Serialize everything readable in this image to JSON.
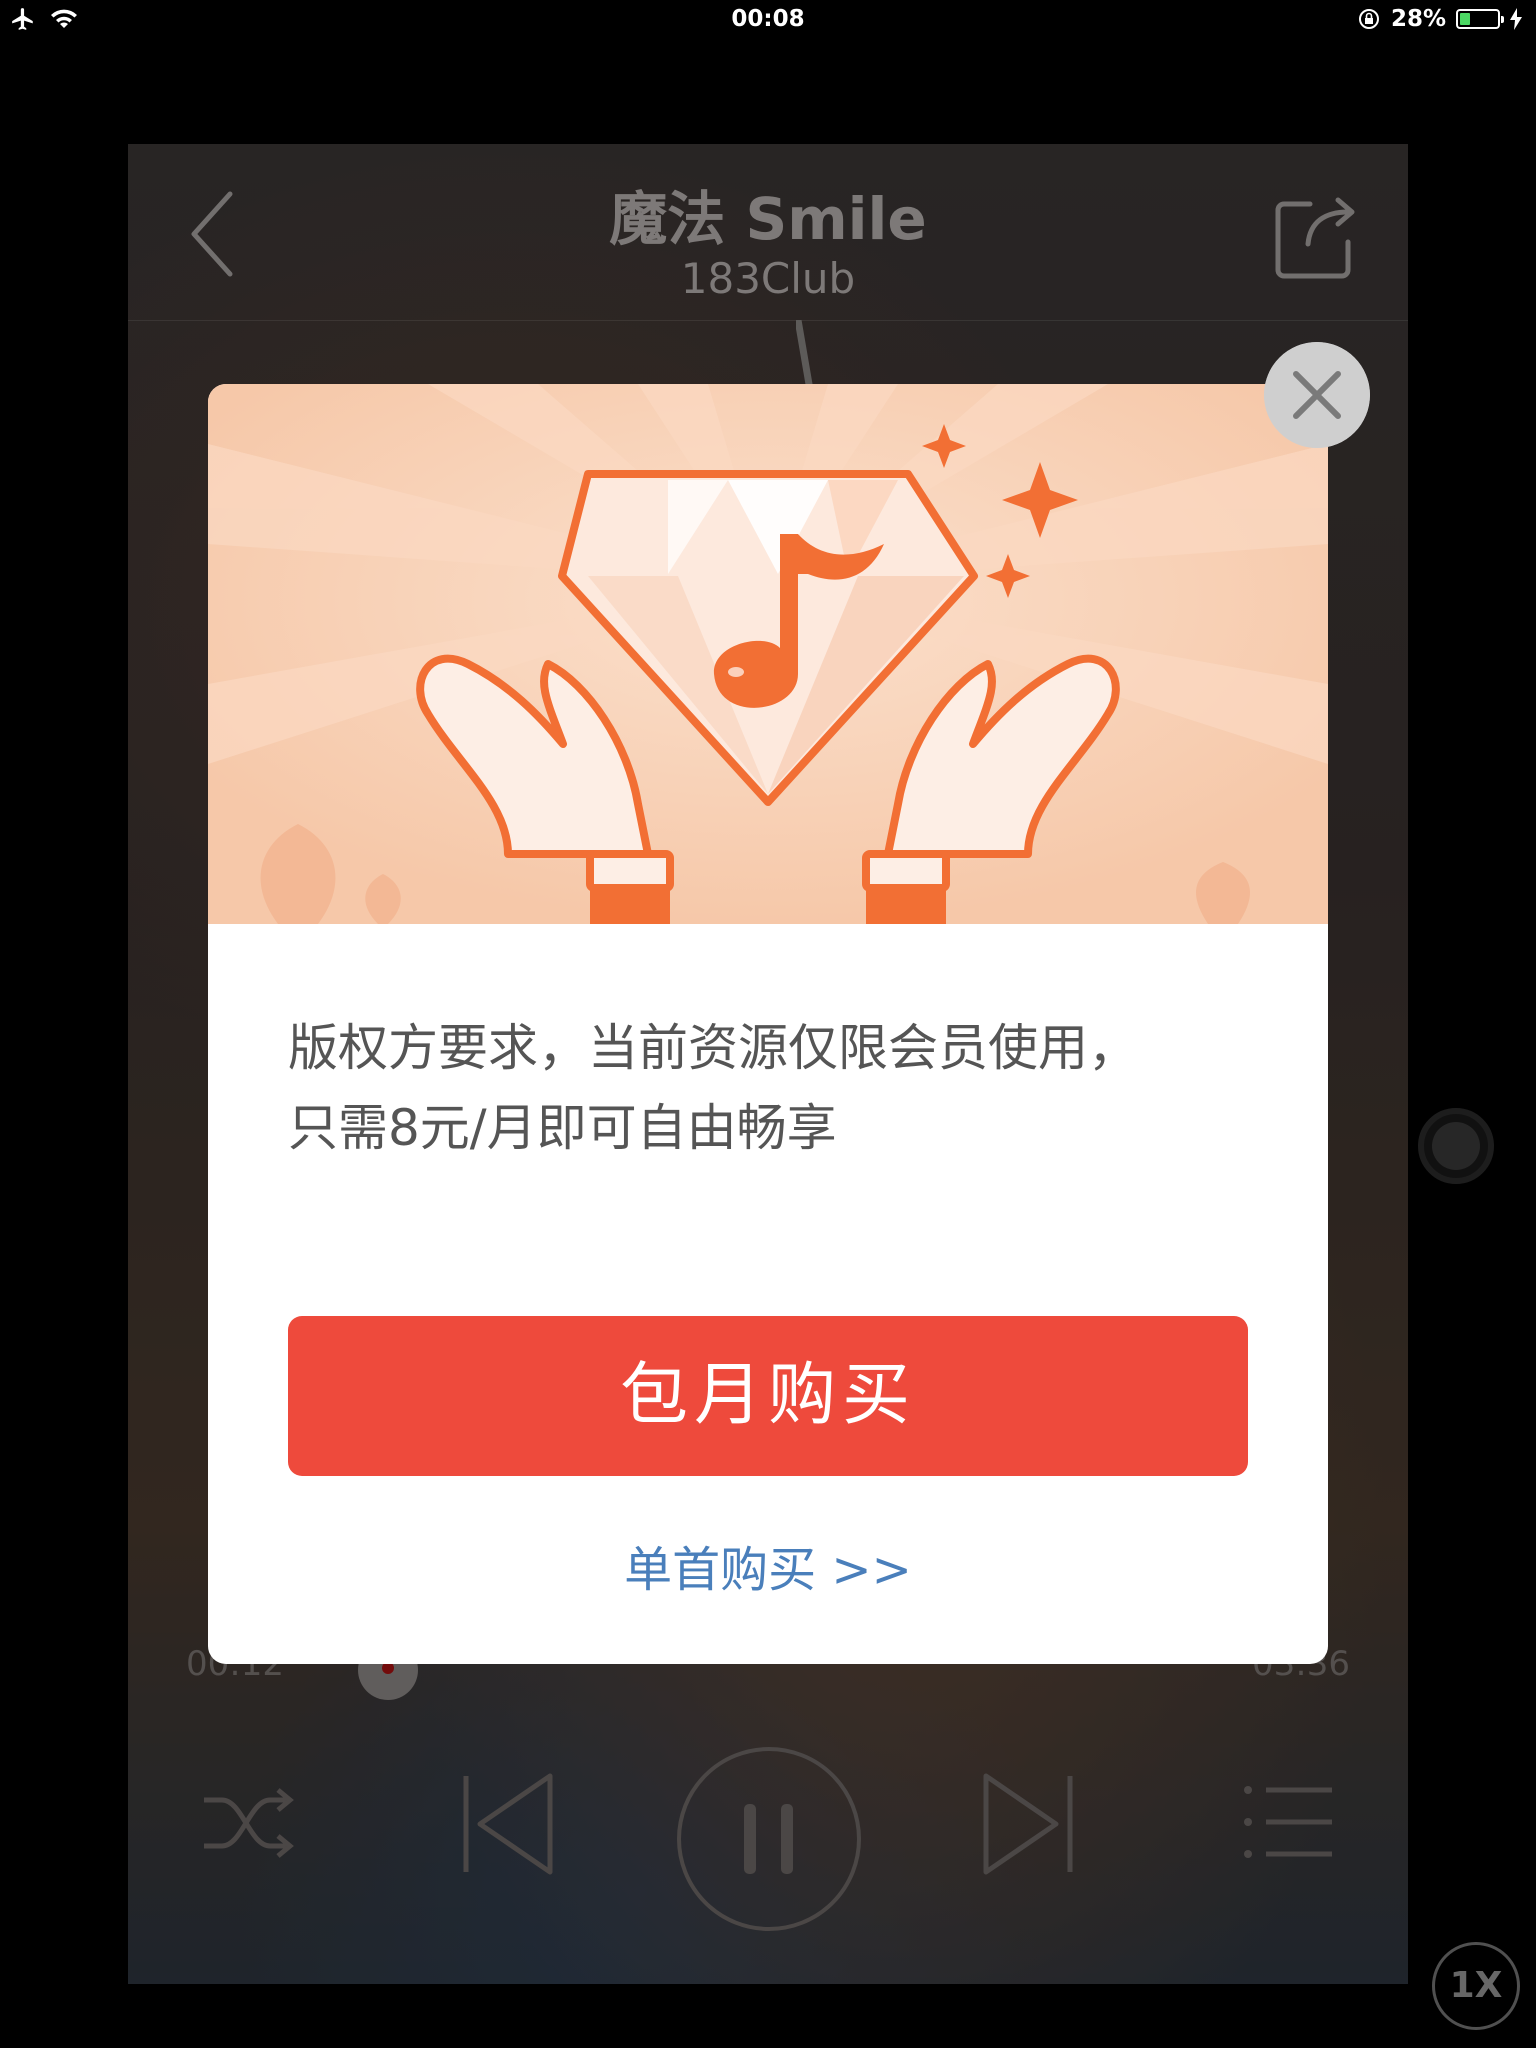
{
  "status_bar": {
    "time": "00:08",
    "battery": "28%"
  },
  "player": {
    "title": "魔法 Smile",
    "artist": "183Club",
    "elapsed": "00:12",
    "duration": "03:36",
    "speed": "1X"
  },
  "modal": {
    "message_line1": "版权方要求，当前资源仅限会员使用，",
    "message_line2": "只需8元/月即可自由畅享",
    "primary_button": "包月购买",
    "secondary_link": "单首购买 >>"
  },
  "colors": {
    "primary_button": "#ee4a3c",
    "link": "#4a7fbb",
    "banner_bg": "#f6c8a9",
    "accent_orange": "#f26f34"
  },
  "icons": [
    "airplane-icon",
    "wifi-icon",
    "rotation-lock-icon",
    "battery-icon",
    "charging-icon",
    "back-arrow-icon",
    "share-icon",
    "shuffle-icon",
    "previous-icon",
    "pause-icon",
    "next-icon",
    "playlist-icon",
    "close-icon",
    "diamond-music-icon"
  ]
}
